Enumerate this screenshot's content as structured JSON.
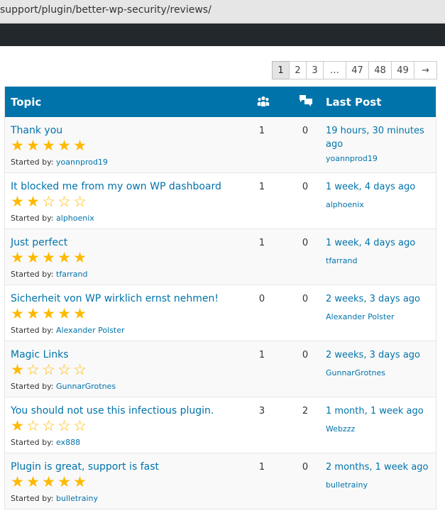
{
  "browser": {
    "url": "support/plugin/better-wp-security/reviews/"
  },
  "pagination": {
    "pages": [
      "1",
      "2",
      "3",
      "…",
      "47",
      "48",
      "49"
    ],
    "current": "1",
    "next": "→"
  },
  "table": {
    "headers": {
      "topic": "Topic",
      "voices_icon": "people-icon",
      "replies_icon": "speech-bubbles-icon",
      "last_post": "Last Post"
    },
    "started_by_label": "Started by:",
    "star_color": "#ffb900",
    "header_color": "#0073aa",
    "link_color": "#0073aa",
    "rows": [
      {
        "title": "Thank you",
        "rating": 5,
        "author": "yoannprod19",
        "voices": "1",
        "replies": "0",
        "last_post": "19 hours, 30 minutes ago",
        "last_by": "yoannprod19"
      },
      {
        "title": "It blocked me from my own WP dashboard",
        "rating": 2,
        "author": "alphoenix",
        "voices": "1",
        "replies": "0",
        "last_post": "1 week, 4 days ago",
        "last_by": "alphoenix"
      },
      {
        "title": "Just perfect",
        "rating": 5,
        "author": "tfarrand",
        "voices": "1",
        "replies": "0",
        "last_post": "1 week, 4 days ago",
        "last_by": "tfarrand"
      },
      {
        "title": "Sicherheit von WP wirklich ernst nehmen!",
        "rating": 5,
        "author": "Alexander Polster",
        "voices": "0",
        "replies": "0",
        "last_post": "2 weeks, 3 days ago",
        "last_by": "Alexander Polster"
      },
      {
        "title": "Magic Links",
        "rating": 1,
        "author": "GunnarGrotnes",
        "voices": "1",
        "replies": "0",
        "last_post": "2 weeks, 3 days ago",
        "last_by": "GunnarGrotnes"
      },
      {
        "title": "You should not use this infectious plugin.",
        "rating": 1,
        "author": "ex888",
        "voices": "3",
        "replies": "2",
        "last_post": "1 month, 1 week ago",
        "last_by": "Webzzz"
      },
      {
        "title": "Plugin is great, support is fast",
        "rating": 5,
        "author": "bulletrainy",
        "voices": "1",
        "replies": "0",
        "last_post": "2 months, 1 week ago",
        "last_by": "bulletrainy"
      }
    ]
  }
}
